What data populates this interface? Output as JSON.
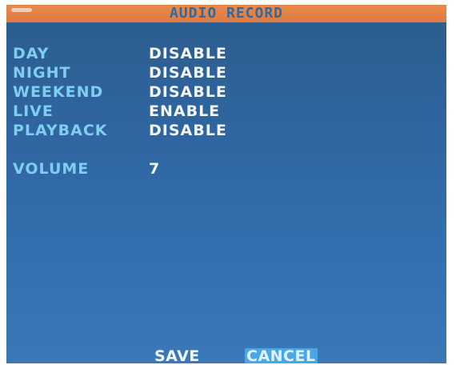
{
  "title": "AUDIO RECORD",
  "settings": [
    {
      "label": "DAY",
      "value": "DISABLE"
    },
    {
      "label": "NIGHT",
      "value": "DISABLE"
    },
    {
      "label": "WEEKEND",
      "value": "DISABLE"
    },
    {
      "label": "LIVE",
      "value": "ENABLE"
    },
    {
      "label": "PLAYBACK",
      "value": "DISABLE"
    }
  ],
  "volume": {
    "label": "VOLUME",
    "value": "7"
  },
  "buttons": {
    "save": "SAVE",
    "cancel": "CANCEL"
  },
  "colors": {
    "title_bar": "#e37f43",
    "background": "#2f65a0",
    "label": "#7fcdf0",
    "value": "#f3f6f8",
    "selected": "#4aa7e6"
  }
}
